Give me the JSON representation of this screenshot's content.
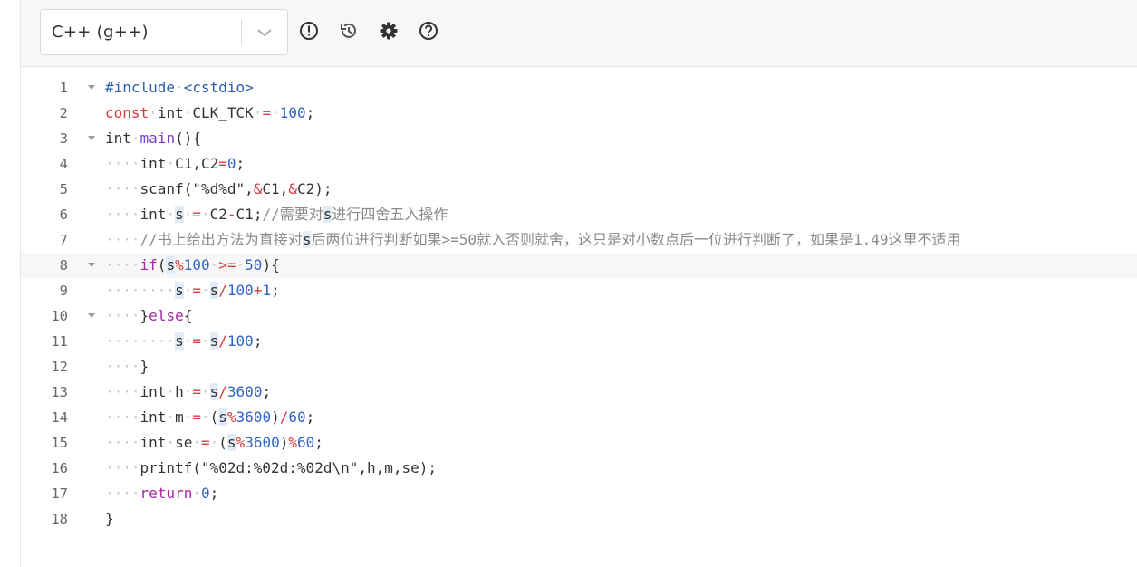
{
  "toolbar": {
    "language": "C++ (g++)",
    "buttons": [
      {
        "name": "info-button",
        "icon": "exclamation-circle-icon"
      },
      {
        "name": "history-button",
        "icon": "history-icon"
      },
      {
        "name": "settings-button",
        "icon": "gear-icon"
      },
      {
        "name": "help-button",
        "icon": "question-circle-icon"
      }
    ]
  },
  "editor": {
    "active_line": 8,
    "lines": [
      {
        "n": "1",
        "fold": true,
        "tokens": [
          [
            "prep",
            "#include"
          ],
          [
            "ind",
            "·"
          ],
          [
            "prep",
            "<cstdio>"
          ]
        ]
      },
      {
        "n": "2",
        "fold": false,
        "tokens": [
          [
            "op",
            "const"
          ],
          [
            "ind",
            "·"
          ],
          [
            "plain",
            "int"
          ],
          [
            "ind",
            "·"
          ],
          [
            "plain",
            "CLK_TCK"
          ],
          [
            "ind",
            "·"
          ],
          [
            "op",
            "="
          ],
          [
            "ind",
            "·"
          ],
          [
            "num",
            "100"
          ],
          [
            "plain",
            ";"
          ]
        ]
      },
      {
        "n": "3",
        "fold": true,
        "tokens": [
          [
            "plain",
            "int"
          ],
          [
            "ind",
            "·"
          ],
          [
            "fn",
            "main"
          ],
          [
            "plain",
            "(){"
          ]
        ]
      },
      {
        "n": "4",
        "fold": false,
        "tokens": [
          [
            "ind",
            "····"
          ],
          [
            "plain",
            "int"
          ],
          [
            "ind",
            "·"
          ],
          [
            "plain",
            "C1,C2"
          ],
          [
            "op",
            "="
          ],
          [
            "num",
            "0"
          ],
          [
            "plain",
            ";"
          ]
        ]
      },
      {
        "n": "5",
        "fold": false,
        "tokens": [
          [
            "ind",
            "····"
          ],
          [
            "plain",
            "scanf(\"%d%d\","
          ],
          [
            "op",
            "&"
          ],
          [
            "plain",
            "C1,"
          ],
          [
            "op",
            "&"
          ],
          [
            "plain",
            "C2);"
          ]
        ]
      },
      {
        "n": "6",
        "fold": false,
        "tokens": [
          [
            "ind",
            "····"
          ],
          [
            "plain",
            "int"
          ],
          [
            "ind",
            "·"
          ],
          [
            "hl",
            "s"
          ],
          [
            "ind",
            "·"
          ],
          [
            "op",
            "="
          ],
          [
            "ind",
            "·"
          ],
          [
            "plain",
            "C2"
          ],
          [
            "op",
            "-"
          ],
          [
            "plain",
            "C1;"
          ],
          [
            "cmt",
            "//需要对"
          ],
          [
            "hl",
            "s"
          ],
          [
            "cmt",
            "进行四舍五入操作"
          ]
        ]
      },
      {
        "n": "7",
        "fold": false,
        "tokens": [
          [
            "ind",
            "····"
          ],
          [
            "cmt",
            "//书上给出方法为直接对"
          ],
          [
            "hl",
            "s"
          ],
          [
            "cmt",
            "后两位进行判断如果>=50就入否则就舍，这只是对小数点后一位进行判断了，如果是1.49这里不适用"
          ]
        ]
      },
      {
        "n": "8",
        "fold": true,
        "tokens": [
          [
            "ind",
            "····"
          ],
          [
            "kw",
            "if"
          ],
          [
            "plain",
            "("
          ],
          [
            "hl",
            "s"
          ],
          [
            "op",
            "%"
          ],
          [
            "num",
            "100"
          ],
          [
            "ind",
            "·"
          ],
          [
            "op",
            ">="
          ],
          [
            "ind",
            "·"
          ],
          [
            "num",
            "50"
          ],
          [
            "plain",
            "){"
          ]
        ]
      },
      {
        "n": "9",
        "fold": false,
        "tokens": [
          [
            "ind",
            "········"
          ],
          [
            "hl",
            "s"
          ],
          [
            "ind",
            "·"
          ],
          [
            "op",
            "="
          ],
          [
            "ind",
            "·"
          ],
          [
            "hl",
            "s"
          ],
          [
            "op",
            "/"
          ],
          [
            "num",
            "100"
          ],
          [
            "op",
            "+"
          ],
          [
            "num",
            "1"
          ],
          [
            "plain",
            ";"
          ]
        ]
      },
      {
        "n": "10",
        "fold": true,
        "tokens": [
          [
            "ind",
            "····"
          ],
          [
            "plain",
            "}"
          ],
          [
            "kw",
            "else"
          ],
          [
            "plain",
            "{"
          ]
        ]
      },
      {
        "n": "11",
        "fold": false,
        "tokens": [
          [
            "ind",
            "········"
          ],
          [
            "hl",
            "s"
          ],
          [
            "ind",
            "·"
          ],
          [
            "op",
            "="
          ],
          [
            "ind",
            "·"
          ],
          [
            "hl",
            "s"
          ],
          [
            "op",
            "/"
          ],
          [
            "num",
            "100"
          ],
          [
            "plain",
            ";"
          ]
        ]
      },
      {
        "n": "12",
        "fold": false,
        "tokens": [
          [
            "ind",
            "····"
          ],
          [
            "plain",
            "}"
          ]
        ]
      },
      {
        "n": "13",
        "fold": false,
        "tokens": [
          [
            "ind",
            "····"
          ],
          [
            "plain",
            "int"
          ],
          [
            "ind",
            "·"
          ],
          [
            "plain",
            "h"
          ],
          [
            "ind",
            "·"
          ],
          [
            "op",
            "="
          ],
          [
            "ind",
            "·"
          ],
          [
            "hl",
            "s"
          ],
          [
            "op",
            "/"
          ],
          [
            "num",
            "3600"
          ],
          [
            "plain",
            ";"
          ]
        ]
      },
      {
        "n": "14",
        "fold": false,
        "tokens": [
          [
            "ind",
            "····"
          ],
          [
            "plain",
            "int"
          ],
          [
            "ind",
            "·"
          ],
          [
            "plain",
            "m"
          ],
          [
            "ind",
            "·"
          ],
          [
            "op",
            "="
          ],
          [
            "ind",
            "·"
          ],
          [
            "plain",
            "("
          ],
          [
            "hl",
            "s"
          ],
          [
            "op",
            "%"
          ],
          [
            "num",
            "3600"
          ],
          [
            "plain",
            ")"
          ],
          [
            "op",
            "/"
          ],
          [
            "num",
            "60"
          ],
          [
            "plain",
            ";"
          ]
        ]
      },
      {
        "n": "15",
        "fold": false,
        "tokens": [
          [
            "ind",
            "····"
          ],
          [
            "plain",
            "int"
          ],
          [
            "ind",
            "·"
          ],
          [
            "plain",
            "se"
          ],
          [
            "ind",
            "·"
          ],
          [
            "op",
            "="
          ],
          [
            "ind",
            "·"
          ],
          [
            "plain",
            "("
          ],
          [
            "hl",
            "s"
          ],
          [
            "op",
            "%"
          ],
          [
            "num",
            "3600"
          ],
          [
            "plain",
            ")"
          ],
          [
            "op",
            "%"
          ],
          [
            "num",
            "60"
          ],
          [
            "plain",
            ";"
          ]
        ]
      },
      {
        "n": "16",
        "fold": false,
        "tokens": [
          [
            "ind",
            "····"
          ],
          [
            "plain",
            "printf(\"%02d:%02d:%02d\\n\",h,m,se);"
          ]
        ]
      },
      {
        "n": "17",
        "fold": false,
        "tokens": [
          [
            "ind",
            "····"
          ],
          [
            "kw",
            "return"
          ],
          [
            "ind",
            "·"
          ],
          [
            "num",
            "0"
          ],
          [
            "plain",
            ";"
          ]
        ]
      },
      {
        "n": "18",
        "fold": false,
        "tokens": [
          [
            "plain",
            "}"
          ]
        ]
      }
    ]
  }
}
